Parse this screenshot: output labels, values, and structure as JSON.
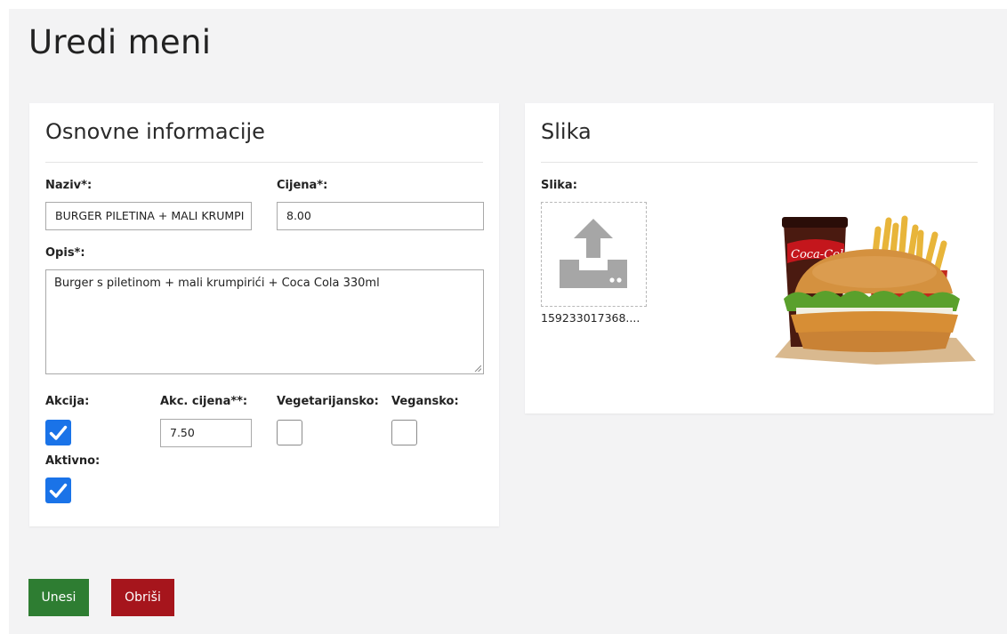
{
  "page": {
    "title": "Uredi meni"
  },
  "info_card": {
    "title": "Osnovne informacije",
    "naziv_label": "Naziv*:",
    "naziv_value": "BURGER PILETINA + MALI KRUMPI",
    "cijena_label": "Cijena*:",
    "cijena_value": "8.00",
    "opis_label": "Opis*:",
    "opis_value": "Burger s  piletinom + mali krumpirići + Coca Cola 330ml",
    "akcija_label": "Akcija:",
    "akcija_checked": true,
    "akc_cijena_label": "Akc. cijena**:",
    "akc_cijena_value": "7.50",
    "vegetarijansko_label": "Vegetarijansko:",
    "vegetarijansko_checked": false,
    "vegansko_label": "Vegansko:",
    "vegansko_checked": false,
    "aktivno_label": "Aktivno:",
    "aktivno_checked": true
  },
  "image_card": {
    "title": "Slika",
    "slika_label": "Slika:",
    "upload_icon": "upload-icon",
    "filename": "159233017368....",
    "product_image": "burger-menu-photo"
  },
  "actions": {
    "save_label": "Unesi",
    "delete_label": "Obriši"
  },
  "colors": {
    "background": "#f3f3f4",
    "checkbox_checked": "#1a73e8",
    "save_button": "#2e7d32",
    "delete_button": "#a6151c"
  }
}
